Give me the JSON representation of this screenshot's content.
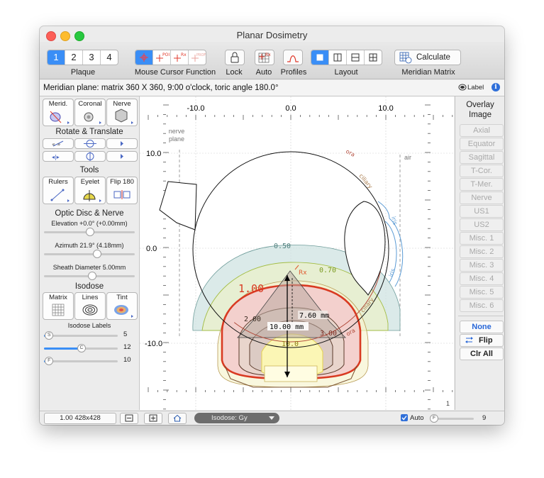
{
  "window": {
    "title": "Planar Dosimetry"
  },
  "toolbar": {
    "plaque_numbers": [
      "1",
      "2",
      "3",
      "4"
    ],
    "plaque_label": "Plaque",
    "cursor_icons": [
      "+",
      "+POI",
      "+Rx",
      "+PROF"
    ],
    "mouse_label": "Mouse Cursor Function",
    "lock_label": "Lock",
    "auto_label": "Auto",
    "auto_icon_text": "Rx",
    "profiles_label": "Profiles",
    "layout_label": "Layout",
    "calculate_label": "Calculate",
    "meridian_label": "Meridian Matrix"
  },
  "info": {
    "text": "Meridian plane: matrix 360 X 360, 9:00 o'clock, toric angle 180.0°",
    "label_toggle": "Label",
    "info_icon": "i"
  },
  "left": {
    "view_buttons": [
      "Merid.",
      "Coronal",
      "Nerve"
    ],
    "rotate_title": "Rotate & Translate",
    "tools_title": "Tools",
    "tool_buttons": [
      "Rulers",
      "Eyelet",
      "Flip 180"
    ],
    "optic_title": "Optic Disc & Nerve",
    "elevation": "Elevation +0.0° (+0.00mm)",
    "azimuth": "Azimuth 21.9° (4.18mm)",
    "sheath": "Sheath Diameter 5.00mm",
    "isodose_title": "Isodose",
    "isodose_buttons": [
      "Matrix",
      "Lines",
      "Tint"
    ],
    "labels_title": "Isodose Labels",
    "label_sliders": [
      {
        "knob": "S",
        "value": "5",
        "fraction": 0.06
      },
      {
        "knob": "C",
        "value": "12",
        "fraction": 0.5
      },
      {
        "knob": "F",
        "value": "10",
        "fraction": 0.06
      }
    ],
    "elevation_fraction": 0.5,
    "azimuth_fraction": 0.58,
    "sheath_fraction": 0.52
  },
  "plot": {
    "top_ticks": [
      "-10.0",
      "0.0",
      "10.0"
    ],
    "left_ticks": [
      "10.0",
      "0.0",
      "-10.0"
    ],
    "nerve_plane": [
      "nerve",
      "plane"
    ],
    "air": "air",
    "ora_top": "ora",
    "ciliary_top": "ciliary",
    "iris": "iris",
    "iris_lower": "iris",
    "ciliary_bottom": "ciliary",
    "ora_bottom": "ora",
    "iso_050": "0.50",
    "iso_070": "0.70",
    "iso_100": "1.00",
    "iso_200": "2.00",
    "iso_300": "3.00",
    "iso_100_inner": "10.0",
    "rx": "Rx",
    "dist_760": "7.60 mm",
    "dist_1000": "10.00 mm",
    "corner": "1",
    "colors": {
      "red": "#d93a22",
      "teal": "#9cc8c6",
      "green": "#b7d36c",
      "lens": "#5b9bd5",
      "brown": "#b24a3a"
    }
  },
  "right": {
    "title": "Overlay Image",
    "buttons": [
      "Axial",
      "Equator",
      "Sagittal",
      "T-Cor.",
      "T-Mer.",
      "Nerve",
      "US1",
      "US2",
      "Misc. 1",
      "Misc. 2",
      "Misc. 3",
      "Misc. 4",
      "Misc. 5",
      "Misc. 6"
    ],
    "none": "None",
    "flip": "Flip",
    "clr_all": "Clr All"
  },
  "bottom": {
    "zoom": "1.00 428x428",
    "isodose_select": "Isodose: Gy",
    "auto_label": "Auto",
    "slider_knob": "F",
    "slider_value": "9",
    "slider_fraction": 0.05
  }
}
